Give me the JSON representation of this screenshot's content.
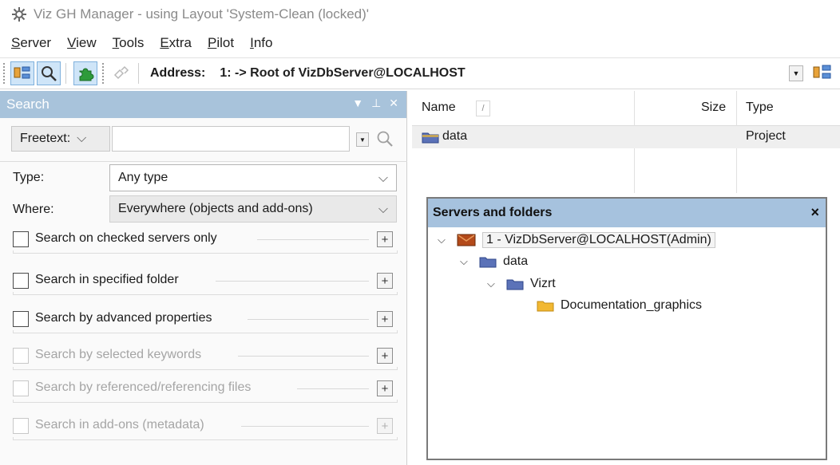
{
  "window": {
    "title": "Viz GH Manager - using Layout 'System-Clean (locked)'"
  },
  "menu": [
    {
      "underline": "S",
      "rest": "erver"
    },
    {
      "underline": "V",
      "rest": "iew"
    },
    {
      "underline": "T",
      "rest": "ools"
    },
    {
      "underline": "E",
      "rest": "xtra"
    },
    {
      "underline": "P",
      "rest": "ilot"
    },
    {
      "underline": "I",
      "rest": "nfo"
    }
  ],
  "toolbar": {
    "address_label": "Address:",
    "address_value": "1: -> Root of VizDbServer@LOCALHOST"
  },
  "search_panel": {
    "title": "Search",
    "freetext_mode": "Freetext:",
    "freetext_value": "",
    "type_label": "Type:",
    "type_value": "Any type",
    "where_label": "Where:",
    "where_value": "Everywhere (objects and add-ons)",
    "sections": [
      {
        "label": "Search on checked servers only",
        "enabled": true,
        "checked": false
      },
      {
        "label": "Search in specified folder",
        "enabled": true,
        "checked": false
      },
      {
        "label": "Search by advanced properties",
        "enabled": true,
        "checked": false
      },
      {
        "label": "Search by selected keywords",
        "enabled": false,
        "checked": false
      },
      {
        "label": "Search by referenced/referencing files",
        "enabled": false,
        "checked": false
      },
      {
        "label": "Search in add-ons (metadata)",
        "enabled": false,
        "checked": false
      }
    ],
    "plus_symbol": "+"
  },
  "file_list": {
    "columns": {
      "name": "Name",
      "sort_glyph": "/",
      "size": "Size",
      "type": "Type"
    },
    "rows": [
      {
        "name": "data",
        "size": "",
        "type": "Project"
      }
    ]
  },
  "servers_panel": {
    "title": "Servers and folders",
    "close_glyph": "×",
    "tree": {
      "server": "1 - VizDbServer@LOCALHOST(Admin)",
      "folder_data": "data",
      "folder_vizrt": "Vizrt",
      "folder_doc": "Documentation_graphics"
    }
  },
  "colors": {
    "panel_header": "#a8c3db",
    "servers_header": "#a6c2de",
    "folder_blue": "#5b72b8",
    "folder_yellow": "#f2b832",
    "server_icon": "#b34a1a"
  }
}
